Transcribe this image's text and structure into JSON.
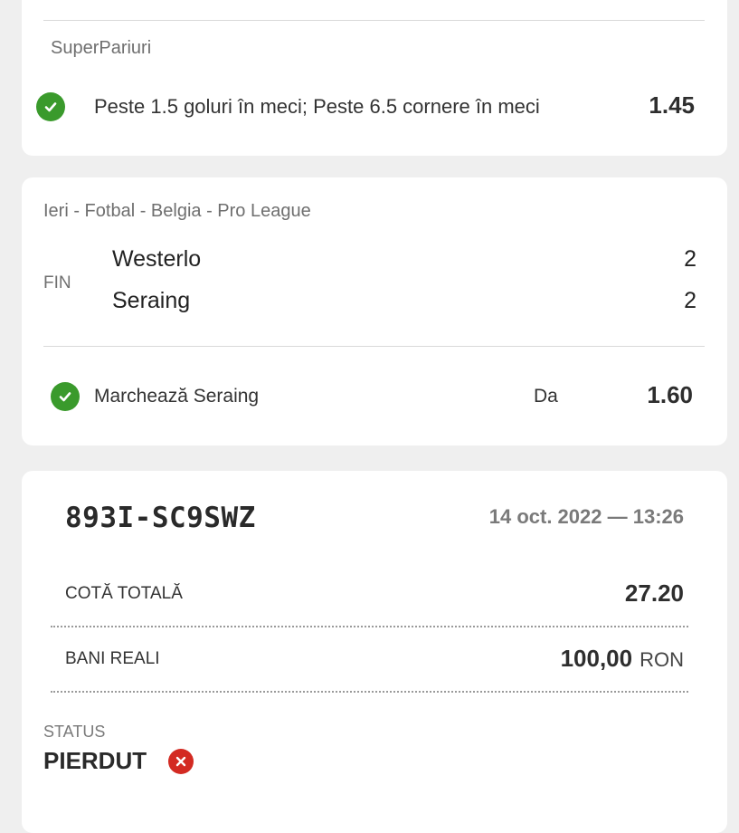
{
  "first_bet": {
    "category": "SuperPariuri",
    "selection": "Peste 1.5 goluri în meci; Peste 6.5 cornere în meci",
    "odds": "1.45"
  },
  "second_bet": {
    "event_info": "Ieri - Fotbal - Belgia - Pro League",
    "match_status": "FIN",
    "home_team": "Westerlo",
    "home_score": "2",
    "away_team": "Seraing",
    "away_score": "2",
    "market": "Marchează Seraing",
    "pick": "Da",
    "odds": "1.60"
  },
  "ticket": {
    "code": "893I-SC9SWZ",
    "datetime": "14 oct. 2022 — 13:26",
    "total_odds_label": "COTĂ TOTALĂ",
    "total_odds": "27.20",
    "stake_label": "BANI REALI",
    "stake_amount": "100,00",
    "stake_currency": "RON",
    "status_label": "STATUS",
    "status_value": "PIERDUT"
  },
  "colors": {
    "success": "#3a9a2c",
    "lost": "#d32a22",
    "background": "#efefef"
  },
  "icons": {
    "won_selection": "check-circle-icon",
    "lost_status": "x-circle-icon"
  }
}
